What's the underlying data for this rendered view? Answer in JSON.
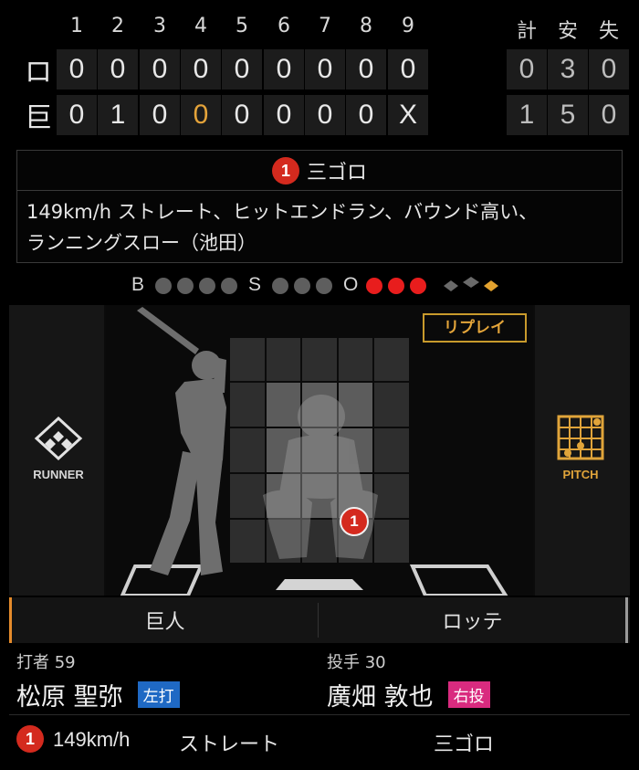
{
  "scoreboard": {
    "innings": [
      "1",
      "2",
      "3",
      "4",
      "5",
      "6",
      "7",
      "8",
      "9"
    ],
    "totals_headers": [
      "計",
      "安",
      "失"
    ],
    "teams": [
      {
        "abbr": "ロ",
        "scores": [
          "0",
          "0",
          "0",
          "0",
          "0",
          "0",
          "0",
          "0",
          "0"
        ],
        "totals": [
          "0",
          "3",
          "0"
        ]
      },
      {
        "abbr": "巨",
        "scores": [
          "0",
          "1",
          "0",
          "0",
          "0",
          "0",
          "0",
          "0",
          "X"
        ],
        "totals": [
          "1",
          "5",
          "0"
        ]
      }
    ],
    "current_cell": "巨 4"
  },
  "play": {
    "number": "1",
    "result": "三ゴロ",
    "description_line1": "149km/h ストレート、ヒットエンドラン、バウンド高い、",
    "description_line2": "ランニングスロー（池田）"
  },
  "count": {
    "balls_label": "B",
    "balls": 0,
    "balls_max": 4,
    "strikes_label": "S",
    "strikes": 0,
    "strikes_max": 3,
    "outs_label": "O",
    "outs": 3,
    "outs_max": 3
  },
  "field": {
    "runner_label": "RUNNER",
    "pitch_label": "PITCH",
    "replay_label": "リプレイ",
    "pitch_marker": "1"
  },
  "teams": {
    "home": "巨人",
    "away": "ロッテ"
  },
  "batter": {
    "role": "打者 59",
    "name": "松原 聖弥",
    "hand": "左打"
  },
  "pitcher": {
    "role": "投手 30",
    "name": "廣畑 敦也",
    "hand": "右投"
  },
  "last_pitch": {
    "number": "1",
    "speed": "149km/h",
    "type": "ストレート",
    "result": "三ゴロ"
  },
  "colors": {
    "accent": "#e4a33a",
    "out": "#e81d1d",
    "badge": "#d42a1e",
    "batter_tag": "#1f69c4",
    "pitcher_tag": "#d92b7f"
  }
}
